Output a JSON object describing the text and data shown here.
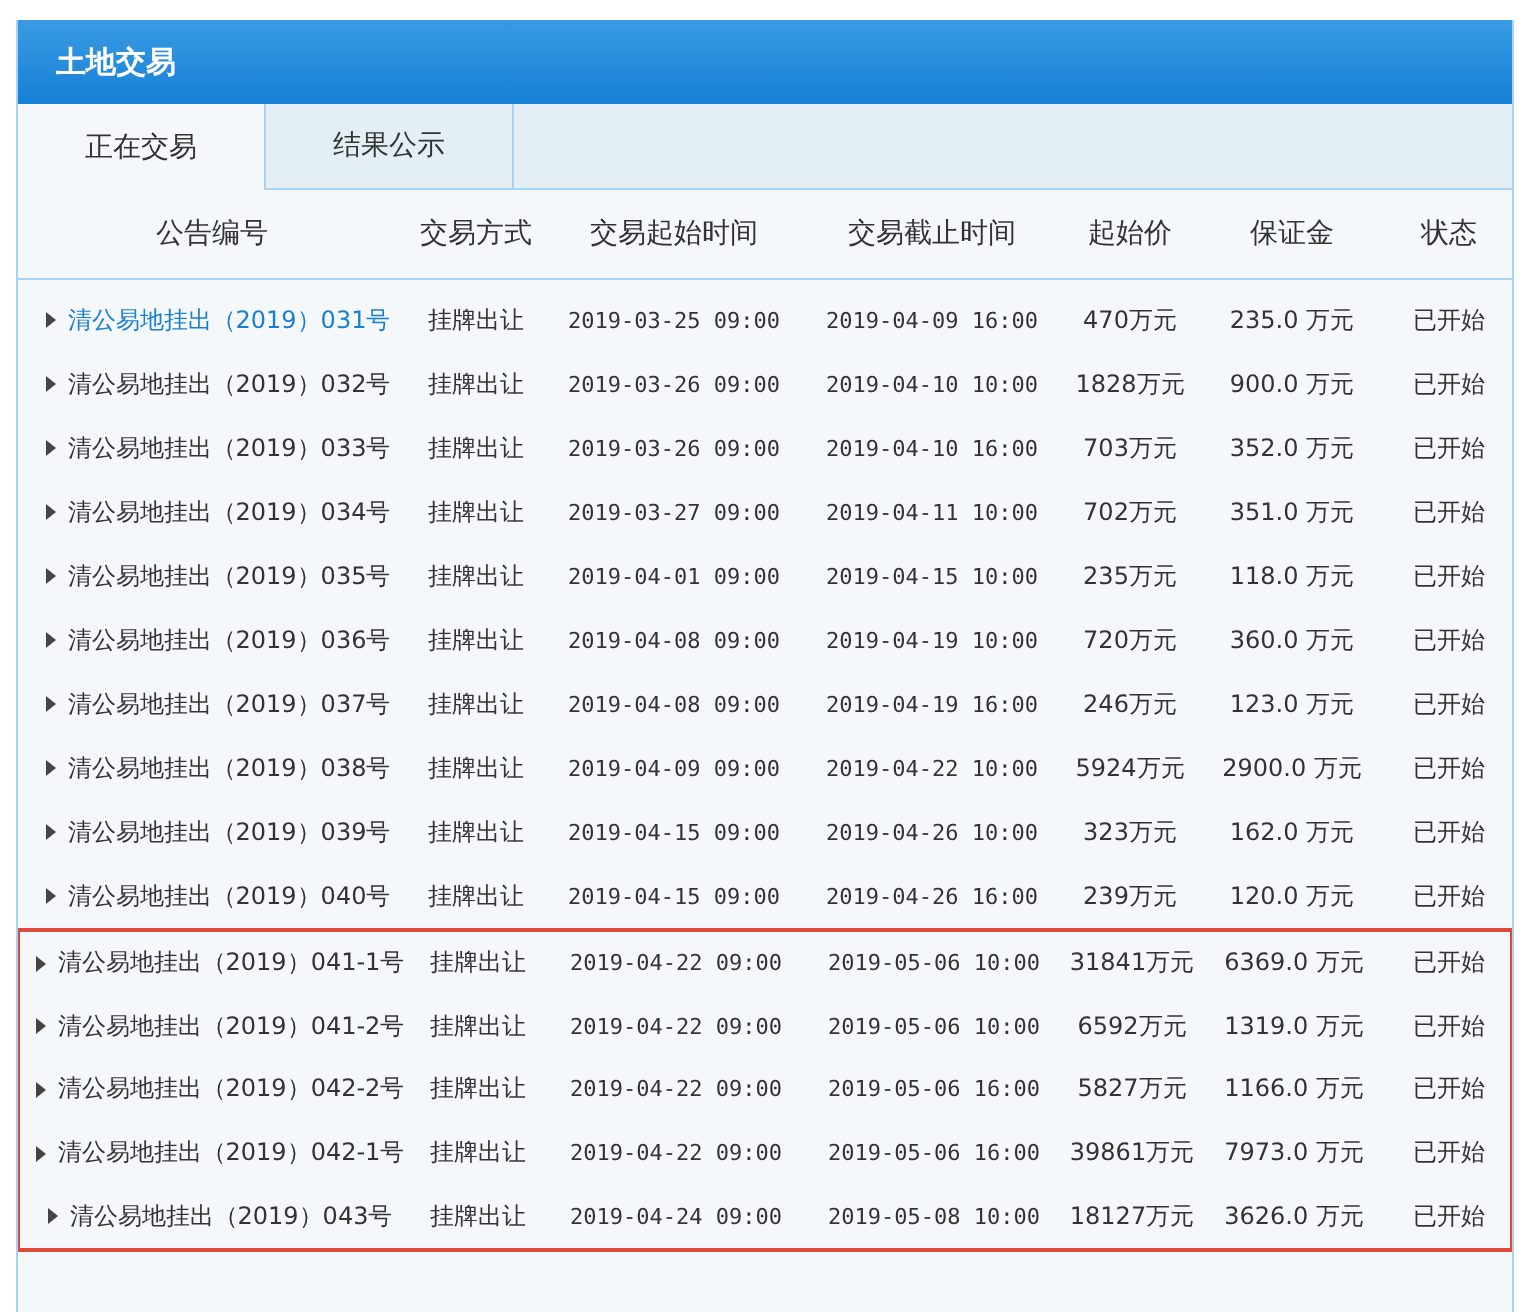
{
  "panel": {
    "title": "土地交易"
  },
  "tabs": [
    {
      "label": "正在交易",
      "selected": true
    },
    {
      "label": "结果公示",
      "selected": false
    }
  ],
  "table": {
    "columns": [
      "公告编号",
      "交易方式",
      "交易起始时间",
      "交易截止时间",
      "起始价",
      "保证金",
      "状态"
    ],
    "rows": [
      {
        "id": "清公易地挂出（2019）031号",
        "method": "挂牌出让",
        "start": "2019-03-25 09:00",
        "end": "2019-04-09 16:00",
        "price": "470万元",
        "deposit": "235.0 万元",
        "status": "已开始",
        "selected": true,
        "outlined": false
      },
      {
        "id": "清公易地挂出（2019）032号",
        "method": "挂牌出让",
        "start": "2019-03-26 09:00",
        "end": "2019-04-10 10:00",
        "price": "1828万元",
        "deposit": "900.0 万元",
        "status": "已开始",
        "selected": false,
        "outlined": false
      },
      {
        "id": "清公易地挂出（2019）033号",
        "method": "挂牌出让",
        "start": "2019-03-26 09:00",
        "end": "2019-04-10 16:00",
        "price": "703万元",
        "deposit": "352.0 万元",
        "status": "已开始",
        "selected": false,
        "outlined": false
      },
      {
        "id": "清公易地挂出（2019）034号",
        "method": "挂牌出让",
        "start": "2019-03-27 09:00",
        "end": "2019-04-11 10:00",
        "price": "702万元",
        "deposit": "351.0 万元",
        "status": "已开始",
        "selected": false,
        "outlined": false
      },
      {
        "id": "清公易地挂出（2019）035号",
        "method": "挂牌出让",
        "start": "2019-04-01 09:00",
        "end": "2019-04-15 10:00",
        "price": "235万元",
        "deposit": "118.0 万元",
        "status": "已开始",
        "selected": false,
        "outlined": false
      },
      {
        "id": "清公易地挂出（2019）036号",
        "method": "挂牌出让",
        "start": "2019-04-08 09:00",
        "end": "2019-04-19 10:00",
        "price": "720万元",
        "deposit": "360.0 万元",
        "status": "已开始",
        "selected": false,
        "outlined": false
      },
      {
        "id": "清公易地挂出（2019）037号",
        "method": "挂牌出让",
        "start": "2019-04-08 09:00",
        "end": "2019-04-19 16:00",
        "price": "246万元",
        "deposit": "123.0 万元",
        "status": "已开始",
        "selected": false,
        "outlined": false
      },
      {
        "id": "清公易地挂出（2019）038号",
        "method": "挂牌出让",
        "start": "2019-04-09 09:00",
        "end": "2019-04-22 10:00",
        "price": "5924万元",
        "deposit": "2900.0 万元",
        "status": "已开始",
        "selected": false,
        "outlined": false
      },
      {
        "id": "清公易地挂出（2019）039号",
        "method": "挂牌出让",
        "start": "2019-04-15 09:00",
        "end": "2019-04-26 10:00",
        "price": "323万元",
        "deposit": "162.0 万元",
        "status": "已开始",
        "selected": false,
        "outlined": false
      },
      {
        "id": "清公易地挂出（2019）040号",
        "method": "挂牌出让",
        "start": "2019-04-15 09:00",
        "end": "2019-04-26 16:00",
        "price": "239万元",
        "deposit": "120.0 万元",
        "status": "已开始",
        "selected": false,
        "outlined": false
      },
      {
        "id": "清公易地挂出（2019）041-1号",
        "method": "挂牌出让",
        "start": "2019-04-22 09:00",
        "end": "2019-05-06 10:00",
        "price": "31841万元",
        "deposit": "6369.0 万元",
        "status": "已开始",
        "selected": false,
        "outlined": true
      },
      {
        "id": "清公易地挂出（2019）041-2号",
        "method": "挂牌出让",
        "start": "2019-04-22 09:00",
        "end": "2019-05-06 10:00",
        "price": "6592万元",
        "deposit": "1319.0 万元",
        "status": "已开始",
        "selected": false,
        "outlined": true
      },
      {
        "id": "清公易地挂出（2019）042-2号",
        "method": "挂牌出让",
        "start": "2019-04-22 09:00",
        "end": "2019-05-06 16:00",
        "price": "5827万元",
        "deposit": "1166.0 万元",
        "status": "已开始",
        "selected": false,
        "outlined": true
      },
      {
        "id": "清公易地挂出（2019）042-1号",
        "method": "挂牌出让",
        "start": "2019-04-22 09:00",
        "end": "2019-05-06 16:00",
        "price": "39861万元",
        "deposit": "7973.0 万元",
        "status": "已开始",
        "selected": false,
        "outlined": true
      },
      {
        "id": "清公易地挂出（2019）043号",
        "method": "挂牌出让",
        "start": "2019-04-24 09:00",
        "end": "2019-05-08 10:00",
        "price": "18127万元",
        "deposit": "3626.0 万元",
        "status": "已开始",
        "selected": false,
        "outlined": true
      }
    ]
  }
}
